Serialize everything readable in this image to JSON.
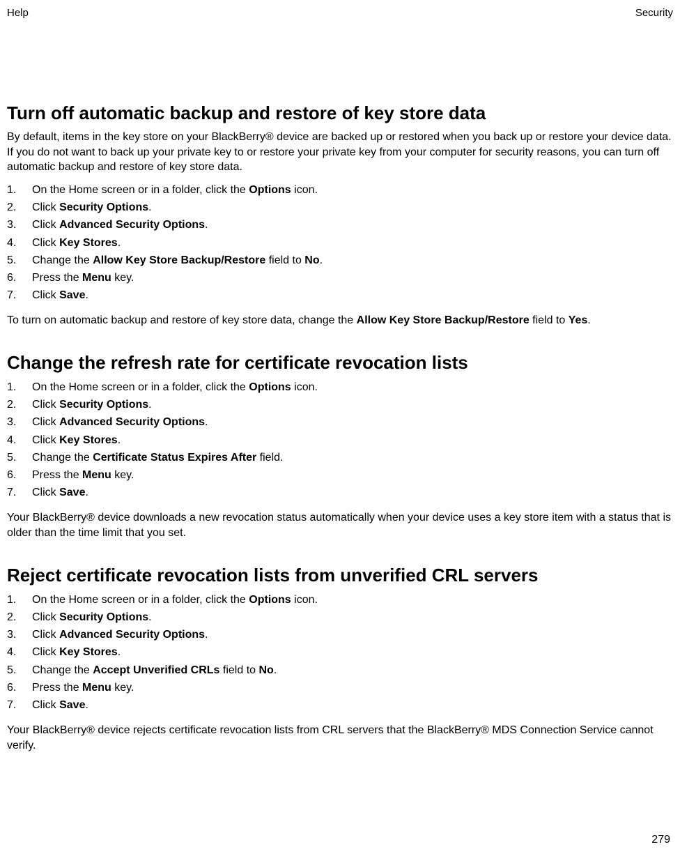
{
  "header": {
    "left": "Help",
    "right": "Security"
  },
  "pageNumber": "279",
  "sections": [
    {
      "title": "Turn off automatic backup and restore of key store data",
      "intro": "By default, items in the key store on your BlackBerry® device are backed up or restored when you back up or restore your device data. If you do not want to back up your private key to or restore your private key from your computer for security reasons, you can turn off automatic backup and restore of key store data.",
      "steps": [
        [
          {
            "t": "On the Home screen or in a folder, click the "
          },
          {
            "t": "Options",
            "b": true
          },
          {
            "t": " icon."
          }
        ],
        [
          {
            "t": "Click "
          },
          {
            "t": "Security Options",
            "b": true
          },
          {
            "t": "."
          }
        ],
        [
          {
            "t": "Click "
          },
          {
            "t": "Advanced Security Options",
            "b": true
          },
          {
            "t": "."
          }
        ],
        [
          {
            "t": "Click "
          },
          {
            "t": "Key Stores",
            "b": true
          },
          {
            "t": "."
          }
        ],
        [
          {
            "t": "Change the "
          },
          {
            "t": "Allow Key Store Backup/Restore",
            "b": true
          },
          {
            "t": " field to "
          },
          {
            "t": "No",
            "b": true
          },
          {
            "t": "."
          }
        ],
        [
          {
            "t": "Press the "
          },
          {
            "t": "Menu",
            "b": true
          },
          {
            "t": " key."
          }
        ],
        [
          {
            "t": "Click "
          },
          {
            "t": "Save",
            "b": true
          },
          {
            "t": "."
          }
        ]
      ],
      "outro": [
        {
          "t": "To turn on automatic backup and restore of key store data, change the "
        },
        {
          "t": "Allow Key Store Backup/Restore",
          "b": true
        },
        {
          "t": " field to "
        },
        {
          "t": "Yes",
          "b": true
        },
        {
          "t": "."
        }
      ]
    },
    {
      "title": "Change the refresh rate for certificate revocation lists",
      "intro": "",
      "steps": [
        [
          {
            "t": "On the Home screen or in a folder, click the "
          },
          {
            "t": "Options",
            "b": true
          },
          {
            "t": " icon."
          }
        ],
        [
          {
            "t": "Click "
          },
          {
            "t": "Security Options",
            "b": true
          },
          {
            "t": "."
          }
        ],
        [
          {
            "t": "Click "
          },
          {
            "t": "Advanced Security Options",
            "b": true
          },
          {
            "t": "."
          }
        ],
        [
          {
            "t": "Click "
          },
          {
            "t": "Key Stores",
            "b": true
          },
          {
            "t": "."
          }
        ],
        [
          {
            "t": "Change the "
          },
          {
            "t": "Certificate Status Expires After",
            "b": true
          },
          {
            "t": " field."
          }
        ],
        [
          {
            "t": "Press the "
          },
          {
            "t": "Menu",
            "b": true
          },
          {
            "t": " key."
          }
        ],
        [
          {
            "t": "Click "
          },
          {
            "t": "Save",
            "b": true
          },
          {
            "t": "."
          }
        ]
      ],
      "outro": [
        {
          "t": "Your BlackBerry® device downloads a new revocation status automatically when your device uses a key store item with a status that is older than the time limit that you set."
        }
      ]
    },
    {
      "title": "Reject certificate revocation lists from unverified CRL servers",
      "intro": "",
      "steps": [
        [
          {
            "t": "On the Home screen or in a folder, click the "
          },
          {
            "t": "Options",
            "b": true
          },
          {
            "t": " icon."
          }
        ],
        [
          {
            "t": "Click "
          },
          {
            "t": "Security Options",
            "b": true
          },
          {
            "t": "."
          }
        ],
        [
          {
            "t": "Click "
          },
          {
            "t": "Advanced Security Options",
            "b": true
          },
          {
            "t": "."
          }
        ],
        [
          {
            "t": "Click "
          },
          {
            "t": "Key Stores",
            "b": true
          },
          {
            "t": "."
          }
        ],
        [
          {
            "t": "Change the "
          },
          {
            "t": "Accept Unverified CRLs",
            "b": true
          },
          {
            "t": " field to "
          },
          {
            "t": "No",
            "b": true
          },
          {
            "t": "."
          }
        ],
        [
          {
            "t": "Press the "
          },
          {
            "t": "Menu",
            "b": true
          },
          {
            "t": " key."
          }
        ],
        [
          {
            "t": "Click "
          },
          {
            "t": "Save",
            "b": true
          },
          {
            "t": "."
          }
        ]
      ],
      "outro": [
        {
          "t": "Your BlackBerry® device rejects certificate revocation lists from CRL servers that the BlackBerry® MDS Connection Service cannot verify."
        }
      ]
    }
  ]
}
